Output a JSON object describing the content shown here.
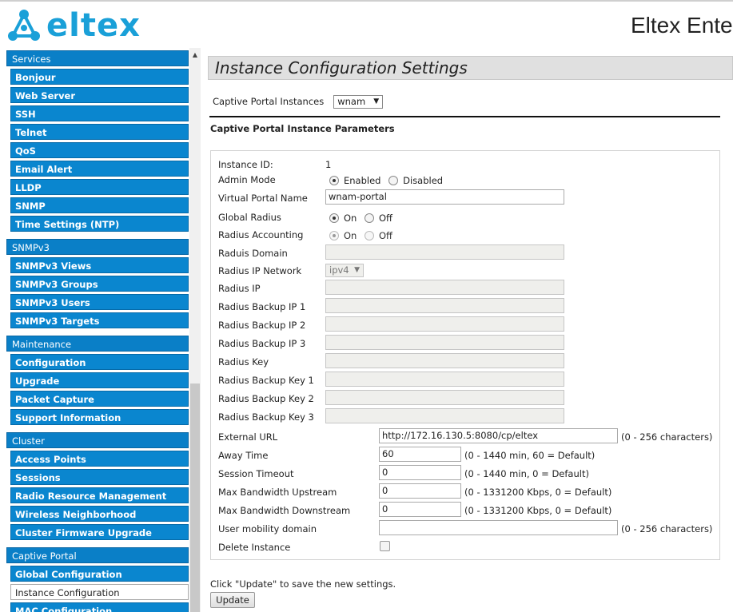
{
  "header": {
    "logo_text": "eltex",
    "title": "Eltex Ente"
  },
  "sidebar": {
    "groups": [
      {
        "label": "Services",
        "items": [
          "Bonjour",
          "Web Server",
          "SSH",
          "Telnet",
          "QoS",
          "Email Alert",
          "LLDP",
          "SNMP",
          "Time Settings (NTP)"
        ]
      },
      {
        "label": "SNMPv3",
        "items": [
          "SNMPv3 Views",
          "SNMPv3 Groups",
          "SNMPv3 Users",
          "SNMPv3 Targets"
        ]
      },
      {
        "label": "Maintenance",
        "items": [
          "Configuration",
          "Upgrade",
          "Packet Capture",
          "Support Information"
        ]
      },
      {
        "label": "Cluster",
        "items": [
          "Access Points",
          "Sessions",
          "Radio Resource Management",
          "Wireless Neighborhood",
          "Cluster Firmware Upgrade"
        ]
      },
      {
        "label": "Captive Portal",
        "items": [
          "Global Configuration",
          "Instance Configuration",
          "MAC Configuration"
        ]
      }
    ],
    "active_item": "Instance Configuration"
  },
  "main": {
    "page_title": "Instance Configuration Settings",
    "instances_label": "Captive Portal Instances",
    "instances_value": "wnam",
    "section_title": "Captive Portal Instance Parameters",
    "fields": {
      "instance_id_label": "Instance ID:",
      "instance_id_value": "1",
      "admin_mode_label": "Admin Mode",
      "admin_mode_enabled": "Enabled",
      "admin_mode_disabled": "Disabled",
      "virtual_portal_name_label": "Virtual Portal Name",
      "virtual_portal_name_value": "wnam-portal",
      "global_radius_label": "Global Radius",
      "on": "On",
      "off": "Off",
      "radius_accounting_label": "Radius Accounting",
      "raduis_domain_label": "Raduis Domain",
      "radius_ip_network_label": "Radius IP Network",
      "radius_ip_network_value": "ipv4",
      "radius_ip_label": "Radius IP",
      "radius_backup_ip_1_label": "Radius Backup IP 1",
      "radius_backup_ip_2_label": "Radius Backup IP 2",
      "radius_backup_ip_3_label": "Radius Backup IP 3",
      "radius_key_label": "Radius Key",
      "radius_backup_key_1_label": "Radius Backup Key 1",
      "radius_backup_key_2_label": "Radius Backup Key 2",
      "radius_backup_key_3_label": "Radius Backup Key 3",
      "external_url_label": "External URL",
      "external_url_value": "http://172.16.130.5:8080/cp/eltex",
      "external_url_hint": "(0 - 256 characters)",
      "away_time_label": "Away Time",
      "away_time_value": "60",
      "away_time_hint": "(0 - 1440 min, 60 = Default)",
      "session_timeout_label": "Session Timeout",
      "session_timeout_value": "0",
      "session_timeout_hint": "(0 - 1440 min, 0 = Default)",
      "max_bw_up_label": "Max Bandwidth Upstream",
      "max_bw_up_value": "0",
      "max_bw_up_hint": "(0 - 1331200 Kbps, 0 = Default)",
      "max_bw_down_label": "Max Bandwidth Downstream",
      "max_bw_down_value": "0",
      "max_bw_down_hint": "(0 - 1331200 Kbps, 0 = Default)",
      "user_mobility_label": "User mobility domain",
      "user_mobility_value": "",
      "user_mobility_hint": "(0 - 256 characters)",
      "delete_instance_label": "Delete Instance"
    },
    "footer_note": "Click \"Update\" to save the new settings.",
    "update_label": "Update"
  }
}
